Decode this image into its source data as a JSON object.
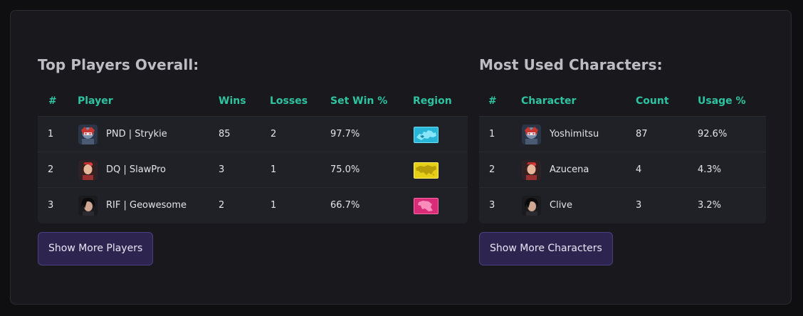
{
  "players": {
    "title": "Top Players Overall:",
    "columns": {
      "rank": "#",
      "player": "Player",
      "wins": "Wins",
      "losses": "Losses",
      "set_win_pct": "Set Win %",
      "region": "Region"
    },
    "rows": [
      {
        "rank": "1",
        "name": "PND | Strykie",
        "wins": "85",
        "losses": "2",
        "set_win_pct": "97.7%",
        "character_icon": "yoshimitsu-avatar",
        "region_icon": "europe-map-icon",
        "region_color": "#2bb8d6"
      },
      {
        "rank": "2",
        "name": "DQ | SlawPro",
        "wins": "3",
        "losses": "1",
        "set_win_pct": "75.0%",
        "character_icon": "azucena-avatar",
        "region_icon": "asia-map-icon",
        "region_color": "#e8d21a"
      },
      {
        "rank": "3",
        "name": "RIF | Geowesome",
        "wins": "2",
        "losses": "1",
        "set_win_pct": "66.7%",
        "character_icon": "clive-avatar",
        "region_icon": "middle-east-map-icon",
        "region_color": "#e0317c"
      }
    ],
    "more_label": "Show More Players"
  },
  "characters": {
    "title": "Most Used Characters:",
    "columns": {
      "rank": "#",
      "character": "Character",
      "count": "Count",
      "usage_pct": "Usage %"
    },
    "rows": [
      {
        "rank": "1",
        "name": "Yoshimitsu",
        "count": "87",
        "usage_pct": "92.6%",
        "character_icon": "yoshimitsu-avatar"
      },
      {
        "rank": "2",
        "name": "Azucena",
        "count": "4",
        "usage_pct": "4.3%",
        "character_icon": "azucena-avatar"
      },
      {
        "rank": "3",
        "name": "Clive",
        "count": "3",
        "usage_pct": "3.2%",
        "character_icon": "clive-avatar"
      }
    ],
    "more_label": "Show More Characters"
  },
  "colors": {
    "accent": "#2ec4a1",
    "button_bg": "#2d2550",
    "button_border": "#4b3f83",
    "row_bg": "#202126",
    "panel_bg": "#19191d"
  }
}
